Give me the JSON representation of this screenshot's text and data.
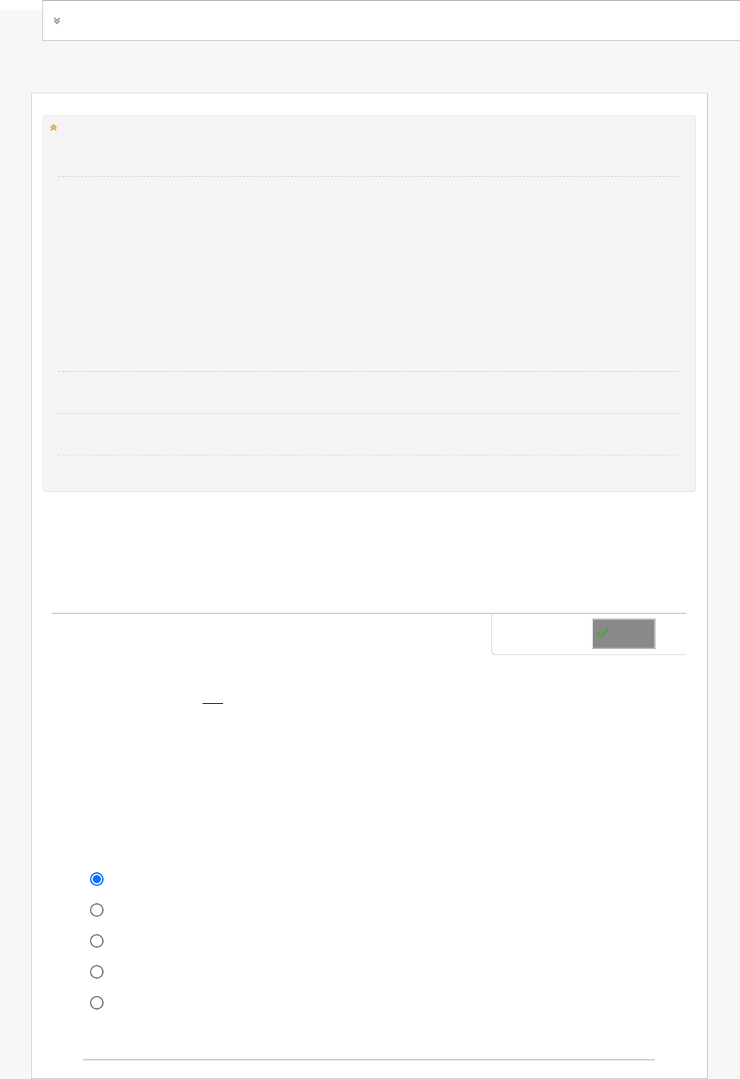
{
  "top_bar": {
    "expanded": false
  },
  "panel": {
    "expanded": true
  },
  "options": [
    {
      "selected": true
    },
    {
      "selected": false
    },
    {
      "selected": false
    },
    {
      "selected": false
    },
    {
      "selected": false
    }
  ]
}
